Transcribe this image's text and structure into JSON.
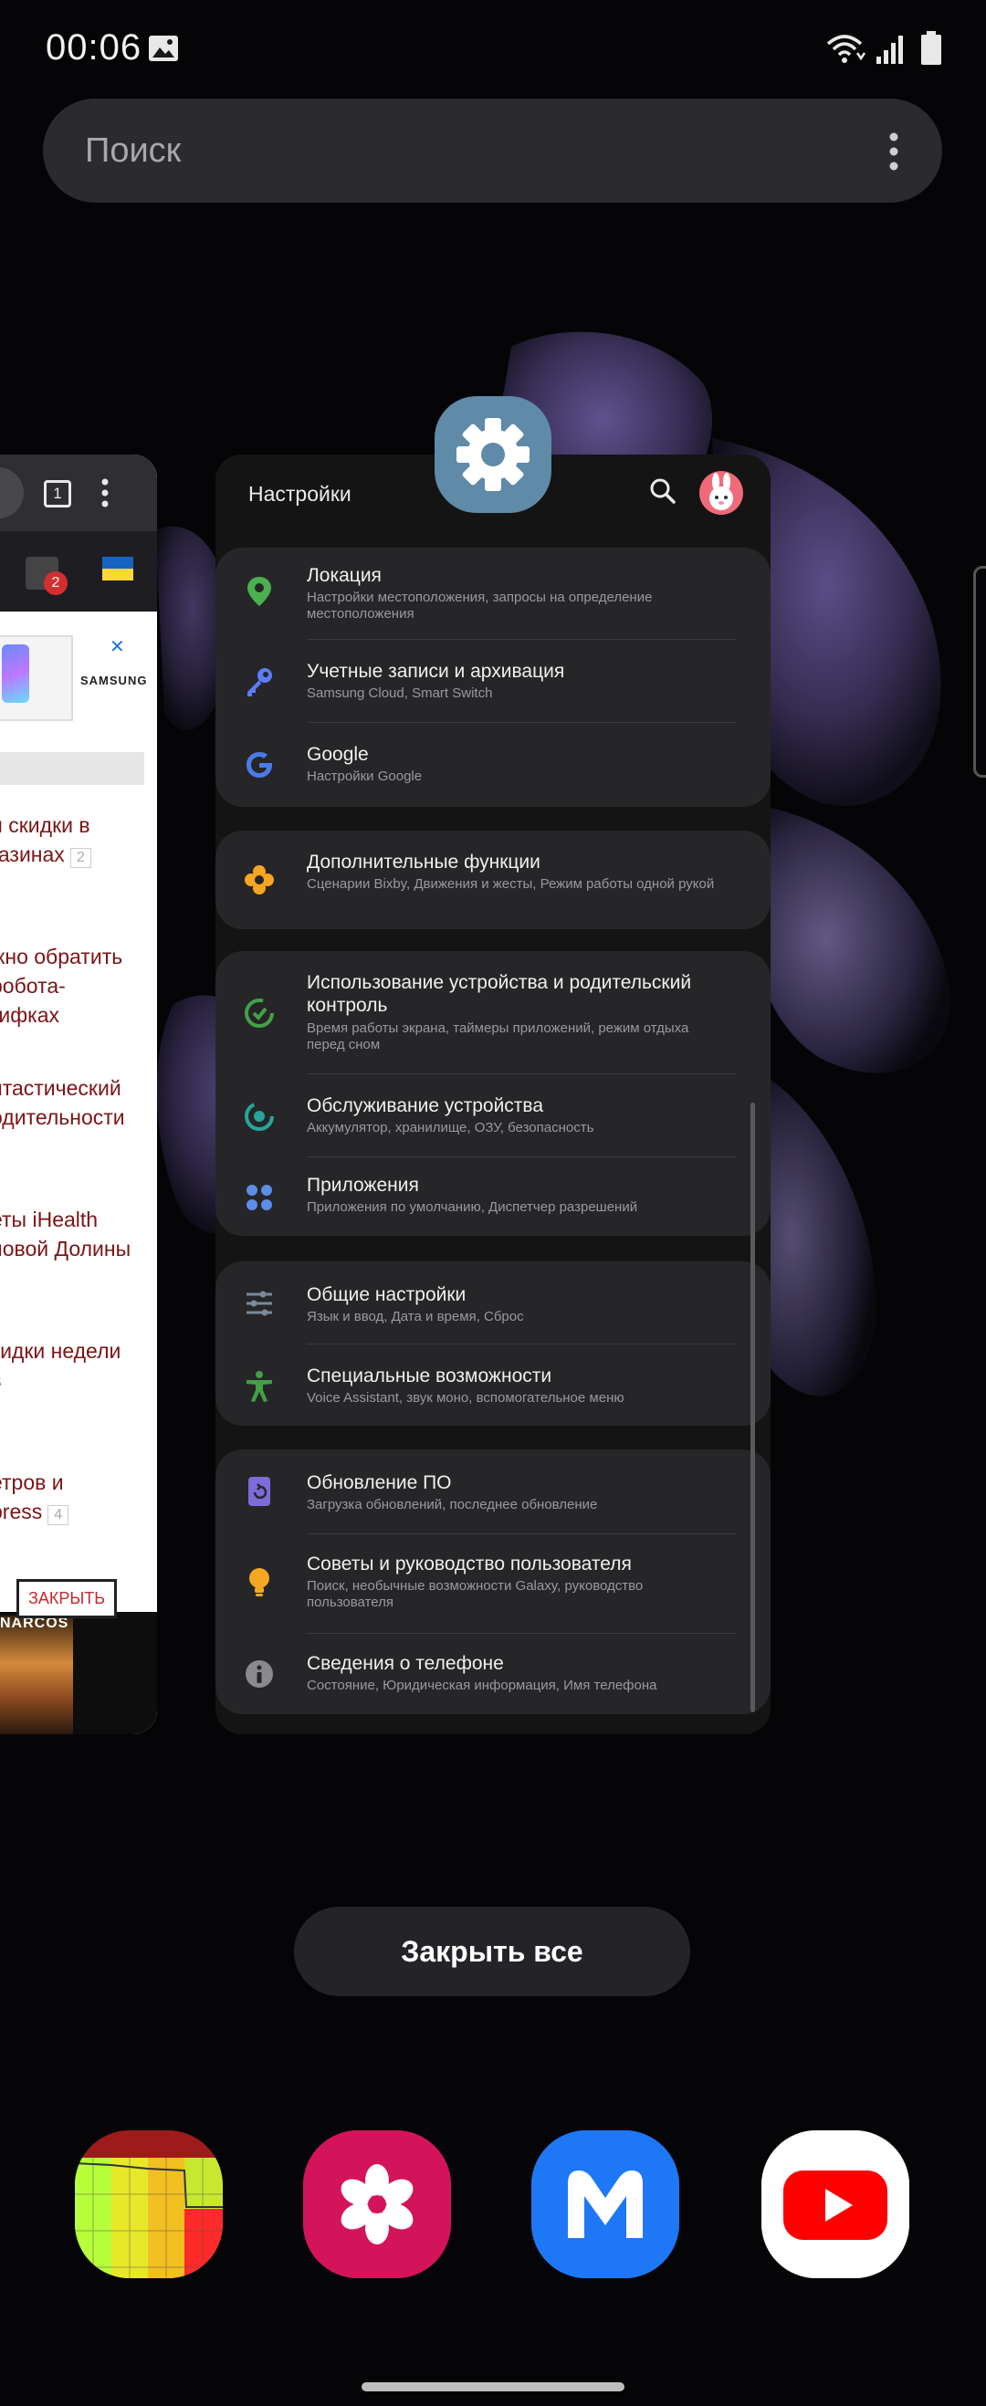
{
  "status_bar": {
    "time": "00:06",
    "icons": [
      "gallery-icon",
      "wifi-icon",
      "signal-icon",
      "battery-icon"
    ]
  },
  "search": {
    "placeholder": "Поиск",
    "menu_icon": "more-vert-icon"
  },
  "browser_card": {
    "tab_count": "1",
    "notification_badge": "2",
    "ad_brand": "SAMSUNG",
    "articles": [
      {
        "text": "и скидки в\nгазинах",
        "count": "2"
      },
      {
        "text": "жно обратить\nробота-\nгифках",
        "count": ""
      },
      {
        "text": "нтастический\nодительности",
        "count": ""
      },
      {
        "text": "еты iHealth\nновой Долины",
        "count": ""
      },
      {
        "text": "кидки недели\ns",
        "count": ""
      },
      {
        "text": "етров и\npress",
        "count": "4"
      }
    ],
    "close_ad_label": "ЗАКРЫТЬ",
    "banner_title": "NARCOS"
  },
  "settings_card": {
    "title": "Настройки",
    "app_icon": "settings-gear-icon",
    "groups": [
      {
        "items": [
          {
            "title": "Локация",
            "subtitle": "Настройки местоположения, запросы на определение местоположения",
            "icon": "location-pin-icon",
            "color": "#4caf50"
          },
          {
            "title": "Учетные записи и архивация",
            "subtitle": "Samsung Cloud, Smart Switch",
            "icon": "key-icon",
            "color": "#5c7cfa"
          },
          {
            "title": "Google",
            "subtitle": "Настройки Google",
            "icon": "google-icon",
            "color": "#4a7be8"
          }
        ]
      },
      {
        "items": [
          {
            "title": "Дополнительные функции",
            "subtitle": "Сценарии Bixby, Движения и жесты, Режим работы одной рукой",
            "icon": "puzzle-flower-icon",
            "color": "#f5a623"
          }
        ]
      },
      {
        "items": [
          {
            "title": "Использование устройства и родительский контроль",
            "subtitle": "Время работы экрана, таймеры приложений, режим отдыха перед сном",
            "icon": "digital-wellbeing-icon",
            "color": "#43a047"
          },
          {
            "title": "Обслуживание устройства",
            "subtitle": "Аккумулятор, хранилище, ОЗУ, безопасность",
            "icon": "device-care-icon",
            "color": "#26a69a"
          },
          {
            "title": "Приложения",
            "subtitle": "Приложения по умолчанию, Диспетчер разрешений",
            "icon": "apps-dots-icon",
            "color": "#5c8de8"
          }
        ]
      },
      {
        "items": [
          {
            "title": "Общие настройки",
            "subtitle": "Язык и ввод, Дата и время, Сброс",
            "icon": "sliders-icon",
            "color": "#7a8a9a"
          },
          {
            "title": "Специальные возможности",
            "subtitle": "Voice Assistant, звук моно, вспомогательное меню",
            "icon": "accessibility-icon",
            "color": "#43a047"
          }
        ]
      },
      {
        "items": [
          {
            "title": "Обновление ПО",
            "subtitle": "Загрузка обновлений, последнее обновление",
            "icon": "software-update-icon",
            "color": "#7b6cd9"
          },
          {
            "title": "Советы и руководство пользователя",
            "subtitle": "Поиск, необычные возможности Galaxy, руководство пользователя",
            "icon": "lightbulb-icon",
            "color": "#f5a623"
          },
          {
            "title": "Сведения о телефоне",
            "subtitle": "Состояние, Юридическая информация, Имя телефона",
            "icon": "info-icon",
            "color": "#8a8a8e"
          }
        ]
      }
    ]
  },
  "close_all": {
    "label": "Закрыть все"
  },
  "dock": [
    {
      "name": "dock-app-monitor",
      "icon": "graph-monitor-icon"
    },
    {
      "name": "dock-app-gallery",
      "icon": "gallery-flower-icon"
    },
    {
      "name": "dock-app-mail",
      "icon": "m-letter-icon"
    },
    {
      "name": "dock-app-youtube",
      "icon": "youtube-icon"
    }
  ]
}
